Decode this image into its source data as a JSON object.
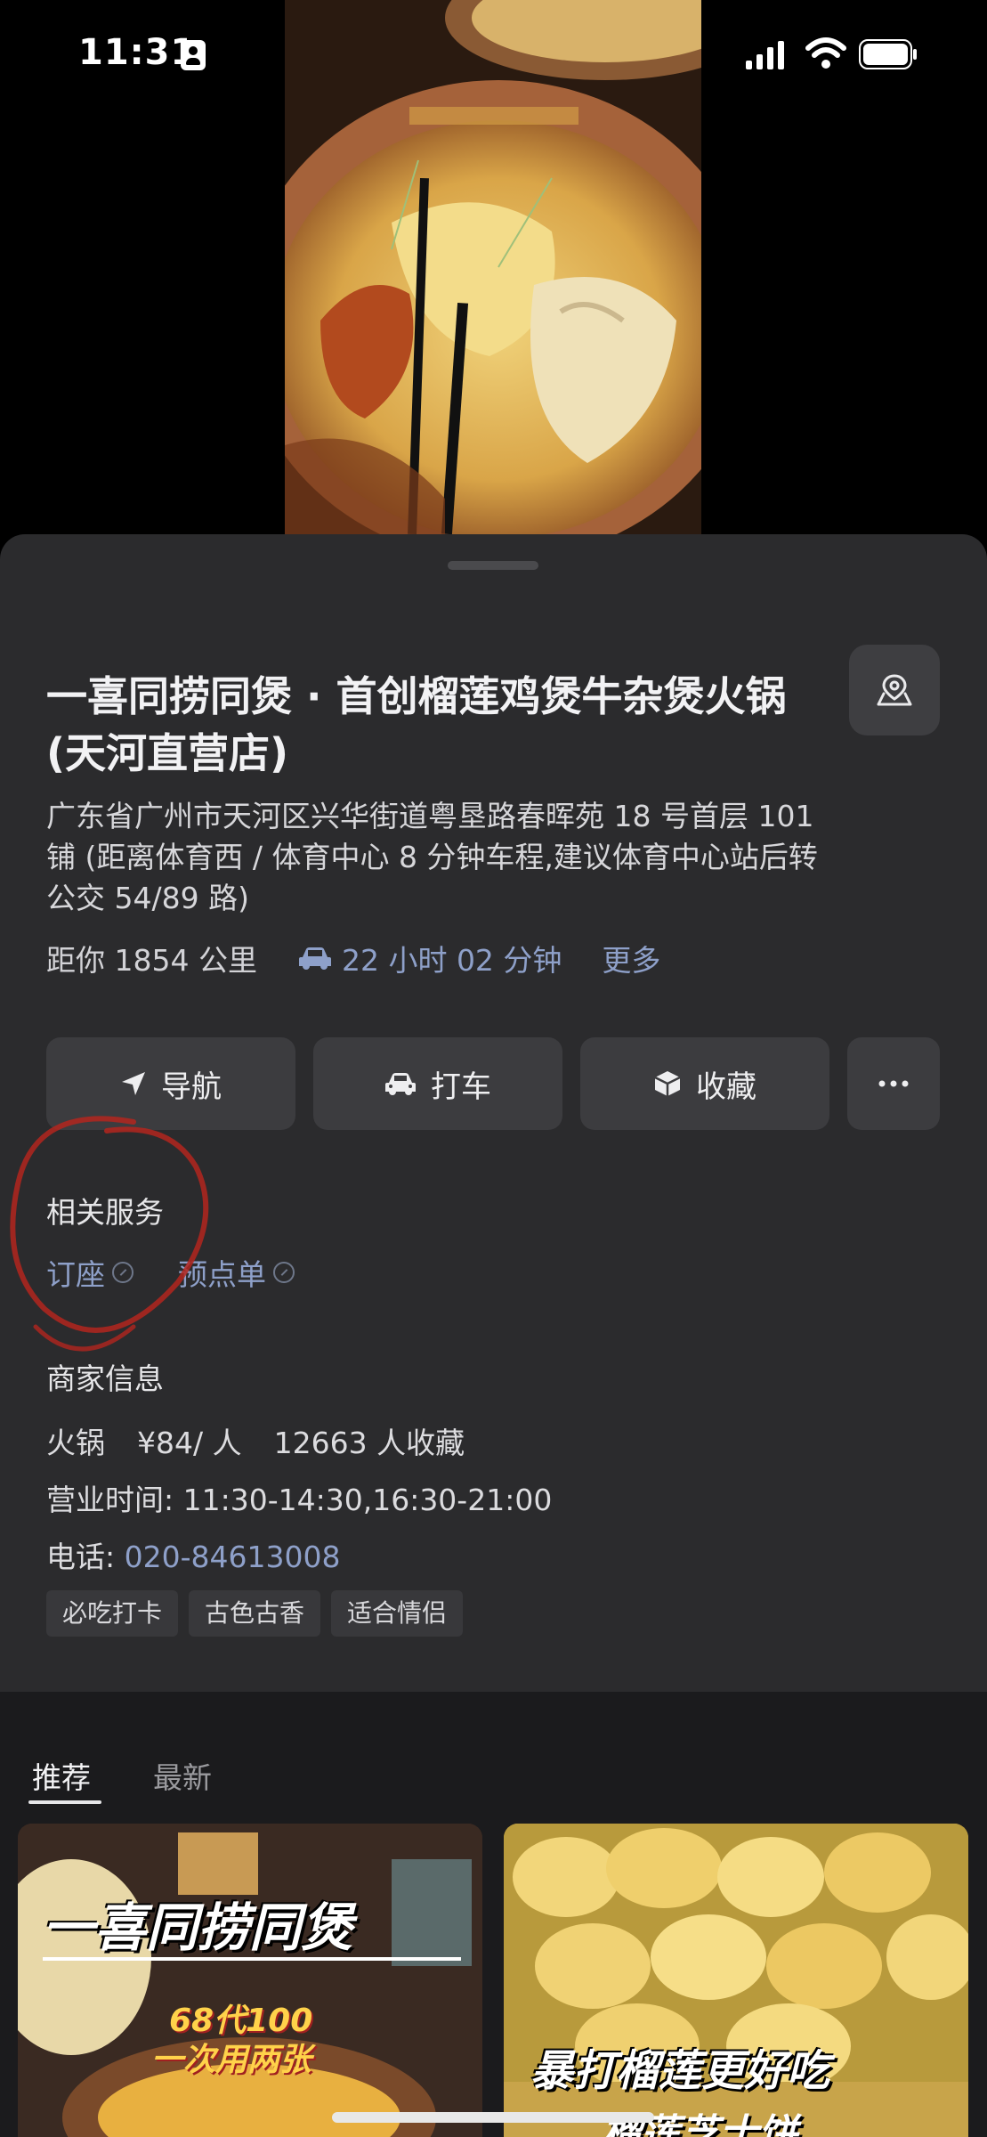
{
  "status_bar": {
    "time": "11:31"
  },
  "store": {
    "title": "一喜同捞同煲 · 首创榴莲鸡煲牛杂煲火锅 (天河直营店)",
    "address": "广东省广州市天河区兴华街道粤垦路春晖苑 18 号首层 101 铺 (距离体育西 / 体育中心 8 分钟车程,建议体育中心站后转公交 54/89 路)",
    "distance": "距你 1854 公里",
    "drive_time": "22 小时 02 分钟",
    "more": "更多"
  },
  "actions": [
    {
      "label": "导航",
      "icon": "navigate-icon"
    },
    {
      "label": "打车",
      "icon": "taxi-icon"
    },
    {
      "label": "收藏",
      "icon": "favorite-icon"
    },
    {
      "label": "",
      "icon": "more-icon"
    }
  ],
  "related_services": {
    "heading": "相关服务",
    "items": [
      "订座",
      "预点单"
    ]
  },
  "merchant_info": {
    "heading": "商家信息",
    "category": "火锅",
    "price": "¥84/ 人",
    "favorites": "12663 人收藏",
    "hours": "营业时间: 11:30-14:30,16:30-21:00",
    "phone_label": "电话: ",
    "phone": "020-84613008",
    "tags": [
      "必吃打卡",
      "古色古香",
      "适合情侣"
    ]
  },
  "feed": {
    "tabs": [
      "推荐",
      "最新"
    ],
    "cards": [
      {
        "headline": "一喜同捞同煲",
        "promo_line1": "68代100",
        "promo_line2": "一次用两张"
      },
      {
        "headline": "暴打榴莲更好吃",
        "subline": "榴莲芝士饼"
      }
    ]
  },
  "colors": {
    "sheet_bg": "#2b2b2d",
    "link_blue": "#8ea0c9",
    "button_bg": "#3c3c3f",
    "annotation_red": "#b3261e"
  }
}
